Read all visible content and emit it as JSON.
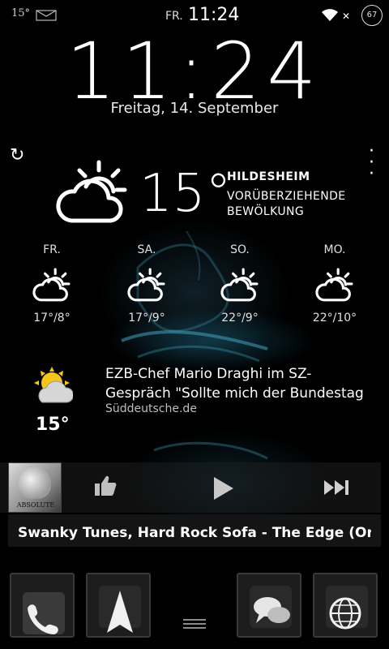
{
  "status_bar": {
    "temp": "15°",
    "day": "FR.",
    "time": "11:24",
    "battery": "67",
    "icons": [
      "mail-icon",
      "wifi-icon",
      "close-icon",
      "battery-icon"
    ]
  },
  "clock": {
    "time": "11:24",
    "date": "Freitag, 14. September"
  },
  "weather": {
    "icons": [
      "refresh-icon",
      "overflow-menu-icon",
      "partly-cloudy-icon"
    ],
    "current_temp": "15°",
    "city": "HILDESHEIM",
    "condition": "VORÜBERZIEHENDE BEWÖLKUNG",
    "forecast": [
      {
        "day": "FR.",
        "temp": "17°/8°"
      },
      {
        "day": "SA.",
        "temp": "17°/9°"
      },
      {
        "day": "SO.",
        "temp": "22°/9°"
      },
      {
        "day": "MO.",
        "temp": "22°/10°"
      }
    ]
  },
  "news": {
    "temp": "15°",
    "headline": "EZB-Chef Mario Draghi im SZ-Gespräch \"Sollte mich der Bundestag",
    "source": "Süddeutsche.de"
  },
  "music": {
    "album_text": "ABSOLUTE",
    "track": "Swanky Tunes, Hard Rock Sofa - The Edge (Origina",
    "icons": [
      "thumbs-up-icon",
      "play-icon",
      "skip-next-icon"
    ]
  },
  "dock": {
    "icons": [
      "phone-icon",
      "navigation-icon",
      "app-drawer-icon",
      "messaging-icon",
      "browser-icon"
    ]
  },
  "colors": {
    "background": "#000000",
    "accent_glow": "#1a7f9e",
    "sun": "#f5c518"
  }
}
